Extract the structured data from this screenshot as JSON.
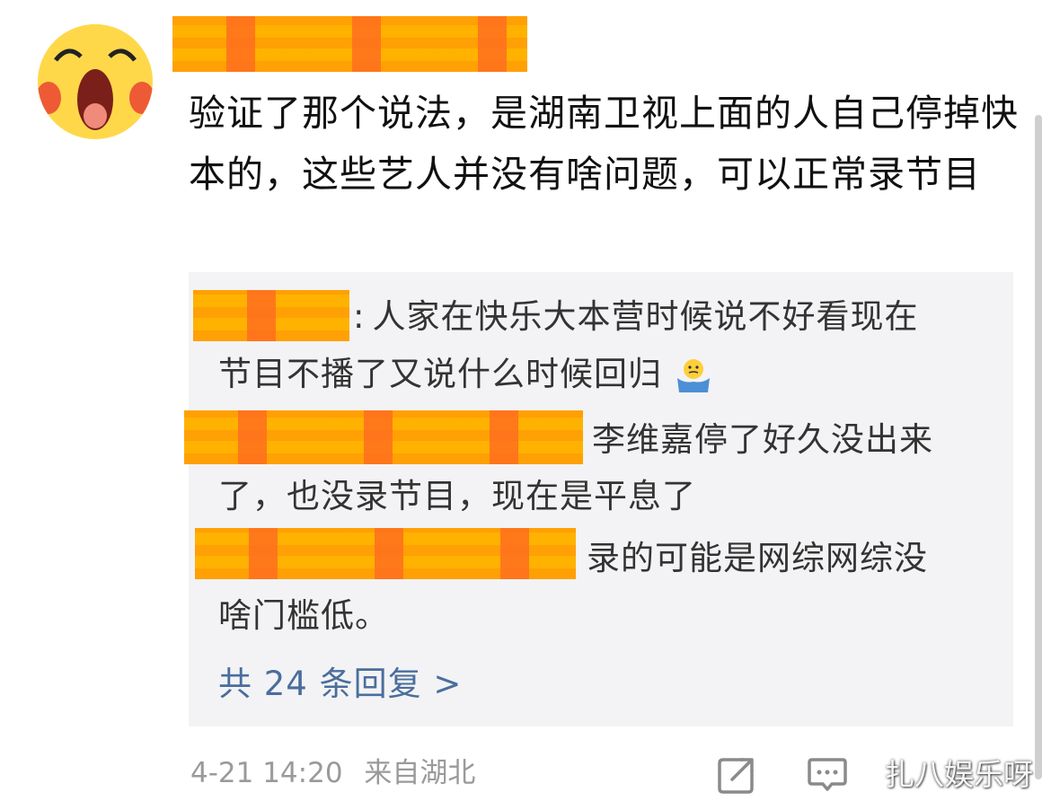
{
  "post": {
    "body": "验证了那个说法，是湖南卫视上面的人自己停掉快本的，这些艺人并没有啥问题，可以正常录节目"
  },
  "replies": [
    {
      "separator": ":",
      "text_line1": "人家在快乐大本营时候说不好看现在",
      "text_line2": "节目不播了又说什么时候回归",
      "emoji": "shrug-emoji"
    },
    {
      "text_line1": "李维嘉停了好久没出来",
      "text_line2": "了，也没录节目，现在是平息了"
    },
    {
      "text_line1": "录的可能是网综网综没",
      "text_line2": "啥门槛低。"
    }
  ],
  "more_replies_label": "共 24 条回复 >",
  "meta": {
    "timestamp": "4-21 14:20",
    "location": "来自湖北"
  },
  "watermark": "扎八娱乐呀",
  "colors": {
    "link": "#4a6e9c",
    "reply_bg": "#f3f3f5",
    "redaction": "#ffb000"
  }
}
